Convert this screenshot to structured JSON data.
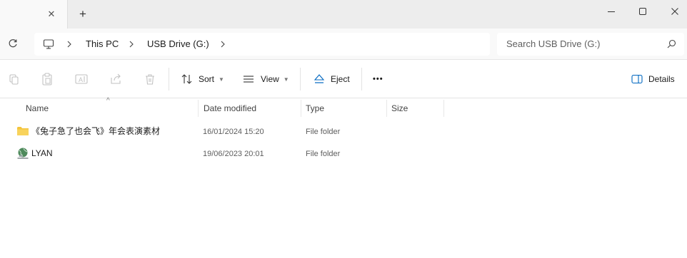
{
  "window": {
    "close_tab_glyph": "✕",
    "new_tab_glyph": "+"
  },
  "address": {
    "breadcrumbs": [
      "This PC",
      "USB Drive (G:)"
    ],
    "search_placeholder": "Search USB Drive (G:)"
  },
  "toolbar": {
    "sort_label": "Sort",
    "view_label": "View",
    "eject_label": "Eject",
    "more_label": "•••",
    "details_label": "Details"
  },
  "columns": {
    "name": "Name",
    "date": "Date modified",
    "type": "Type",
    "size": "Size"
  },
  "files": [
    {
      "name": "《兔子急了也会飞》年会表演素材",
      "date": "16/01/2024 15:20",
      "type": "File folder",
      "size": "",
      "icon": "folder-icon"
    },
    {
      "name": "LYAN",
      "date": "19/06/2023 20:01",
      "type": "File folder",
      "size": "",
      "icon": "globe-folder-icon"
    }
  ],
  "colors": {
    "titlebar": "#ededed",
    "folder": "#f4c43c",
    "accent": "#0067c0"
  }
}
